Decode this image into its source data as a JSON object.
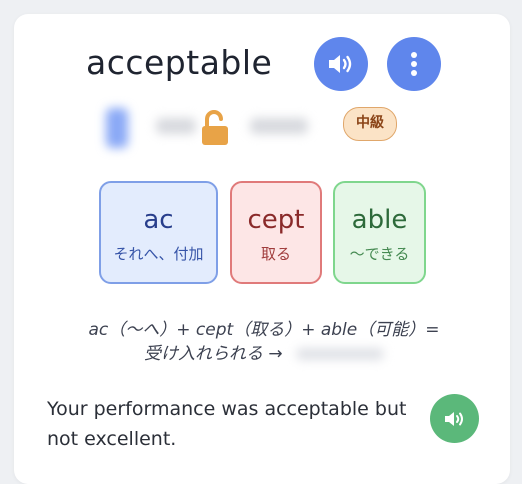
{
  "word": "acceptable",
  "level_badge": "中級",
  "morphemes": [
    {
      "part": "ac",
      "meaning": "それへ、付加"
    },
    {
      "part": "cept",
      "meaning": "取る"
    },
    {
      "part": "able",
      "meaning": "～できる"
    }
  ],
  "etymology": {
    "line1": "ac（～へ）+ cept（取る）+ able（可能）=",
    "line2": "受け入れられる →"
  },
  "example": {
    "sentence": "Your performance was acceptable but not excellent."
  },
  "icons": {
    "sound": "speaker-icon",
    "more": "more-vertical-icon",
    "lock": "unlocked-lock-icon"
  },
  "colors": {
    "primary": "#5f86ec",
    "success": "#5bb87a",
    "lock": "#e8a347"
  }
}
